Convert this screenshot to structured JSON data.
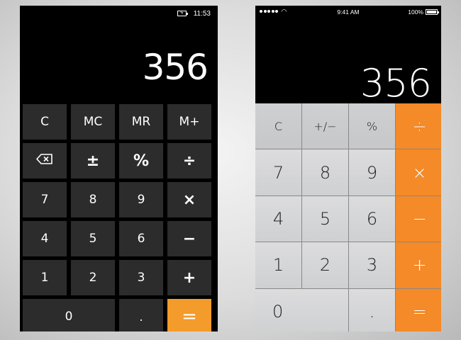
{
  "windows_phone": {
    "status": {
      "battery_icon": "battery-charging-icon",
      "time": "11:53"
    },
    "display": "356",
    "keys": [
      {
        "name": "clear-button",
        "label": "C",
        "cls": ""
      },
      {
        "name": "memory-clear-button",
        "label": "MC",
        "cls": ""
      },
      {
        "name": "memory-recall-button",
        "label": "MR",
        "cls": ""
      },
      {
        "name": "memory-add-button",
        "label": "M+",
        "cls": ""
      },
      {
        "name": "backspace-button",
        "label": "",
        "cls": "",
        "icon": "backspace-icon"
      },
      {
        "name": "plus-minus-button",
        "label": "±",
        "cls": "op"
      },
      {
        "name": "percent-button",
        "label": "%",
        "cls": "op"
      },
      {
        "name": "divide-button",
        "label": "÷",
        "cls": "op"
      },
      {
        "name": "digit-7-button",
        "label": "7",
        "cls": ""
      },
      {
        "name": "digit-8-button",
        "label": "8",
        "cls": ""
      },
      {
        "name": "digit-9-button",
        "label": "9",
        "cls": ""
      },
      {
        "name": "multiply-button",
        "label": "×",
        "cls": "op"
      },
      {
        "name": "digit-4-button",
        "label": "4",
        "cls": ""
      },
      {
        "name": "digit-5-button",
        "label": "5",
        "cls": ""
      },
      {
        "name": "digit-6-button",
        "label": "6",
        "cls": ""
      },
      {
        "name": "minus-button",
        "label": "−",
        "cls": "op"
      },
      {
        "name": "digit-1-button",
        "label": "1",
        "cls": ""
      },
      {
        "name": "digit-2-button",
        "label": "2",
        "cls": ""
      },
      {
        "name": "digit-3-button",
        "label": "3",
        "cls": ""
      },
      {
        "name": "plus-button",
        "label": "+",
        "cls": "op"
      },
      {
        "name": "digit-0-button",
        "label": "0",
        "cls": "wide"
      },
      {
        "name": "decimal-button",
        "label": ".",
        "cls": "small"
      },
      {
        "name": "equals-button",
        "label": "=",
        "cls": "accent"
      }
    ],
    "accent_color": "#f39b2b"
  },
  "ios": {
    "status": {
      "time": "9:41 AM",
      "battery": "100%"
    },
    "display": "356",
    "keys": [
      {
        "name": "clear-button",
        "label": "C",
        "cls": "top"
      },
      {
        "name": "plus-minus-button",
        "label": "+/−",
        "cls": "top"
      },
      {
        "name": "percent-button",
        "label": "%",
        "cls": "top"
      },
      {
        "name": "divide-button",
        "label": "÷",
        "cls": "op"
      },
      {
        "name": "digit-7-button",
        "label": "7",
        "cls": ""
      },
      {
        "name": "digit-8-button",
        "label": "8",
        "cls": ""
      },
      {
        "name": "digit-9-button",
        "label": "9",
        "cls": ""
      },
      {
        "name": "multiply-button",
        "label": "×",
        "cls": "op"
      },
      {
        "name": "digit-4-button",
        "label": "4",
        "cls": ""
      },
      {
        "name": "digit-5-button",
        "label": "5",
        "cls": ""
      },
      {
        "name": "digit-6-button",
        "label": "6",
        "cls": ""
      },
      {
        "name": "minus-button",
        "label": "−",
        "cls": "op"
      },
      {
        "name": "digit-1-button",
        "label": "1",
        "cls": ""
      },
      {
        "name": "digit-2-button",
        "label": "2",
        "cls": ""
      },
      {
        "name": "digit-3-button",
        "label": "3",
        "cls": ""
      },
      {
        "name": "plus-button",
        "label": "+",
        "cls": "op"
      },
      {
        "name": "digit-0-button",
        "label": "0",
        "cls": "zero"
      },
      {
        "name": "decimal-button",
        "label": ".",
        "cls": "dotkey"
      },
      {
        "name": "equals-button",
        "label": "=",
        "cls": "op"
      }
    ],
    "accent_color": "#f48a28"
  }
}
